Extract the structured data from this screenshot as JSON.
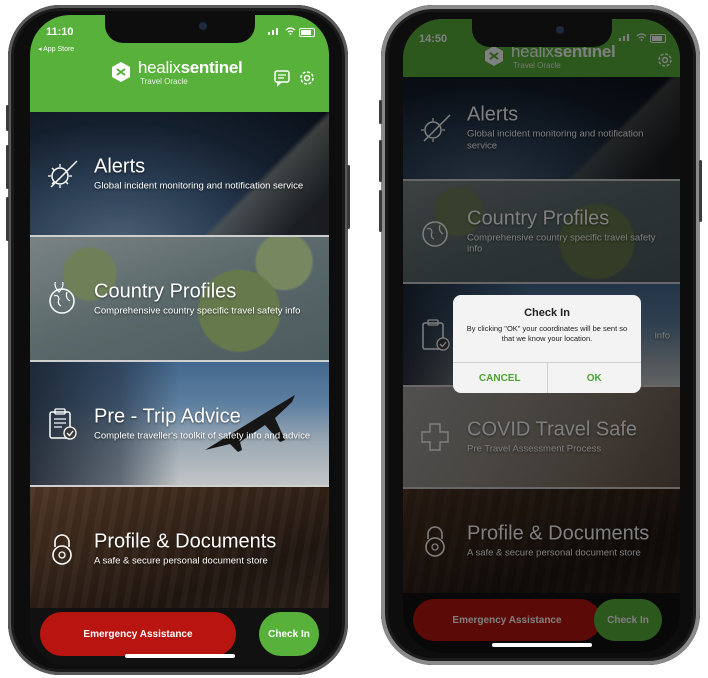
{
  "left_screen": {
    "status": {
      "time": "11:10",
      "back_label": "◂ App Store"
    },
    "brand": {
      "name_bold": "healix",
      "name_rest": "sentinel",
      "tagline": "Travel Oracle"
    },
    "tiles": [
      {
        "title": "Alerts",
        "subtitle": "Global incident monitoring and notification service",
        "icon": "virus-alert-icon"
      },
      {
        "title": "Country Profiles",
        "subtitle": "Comprehensive country specific travel safety info",
        "icon": "globe-location-icon"
      },
      {
        "title": "Pre - Trip Advice",
        "subtitle": "Complete traveller's toolkit of safety info and advice",
        "icon": "clipboard-check-icon"
      },
      {
        "title": "Profile & Documents",
        "subtitle": "A safe & secure personal document store",
        "icon": "padlock-icon"
      }
    ],
    "buttons": {
      "emergency": "Emergency Assistance",
      "checkin": "Check In"
    }
  },
  "right_screen": {
    "status": {
      "time": "14:50"
    },
    "brand": {
      "name_bold": "healix",
      "name_rest": "sentinel",
      "tagline": "Travel Oracle"
    },
    "tiles": [
      {
        "title": "Alerts",
        "subtitle": "Global incident monitoring and notification service",
        "icon": "virus-alert-icon"
      },
      {
        "title": "Country Profiles",
        "subtitle": "Comprehensive country specific travel safety info",
        "icon": "globe-location-icon"
      },
      {
        "title": "",
        "subtitle": "info",
        "icon": "clipboard-check-icon"
      },
      {
        "title": "COVID Travel Safe",
        "subtitle": "Pre Travel Assessment Process",
        "icon": "medical-cross-icon"
      },
      {
        "title": "Profile & Documents",
        "subtitle": "A safe & secure personal document store",
        "icon": "padlock-icon"
      }
    ],
    "buttons": {
      "emergency": "Emergency Assistance",
      "checkin": "Check In"
    },
    "dialog": {
      "title": "Check In",
      "message": "By clicking \"OK\" your coordinates will be sent so that we know your location.",
      "cancel": "CANCEL",
      "ok": "OK"
    }
  },
  "colors": {
    "brand_green": "#58b13a",
    "emergency_red": "#b81410"
  }
}
